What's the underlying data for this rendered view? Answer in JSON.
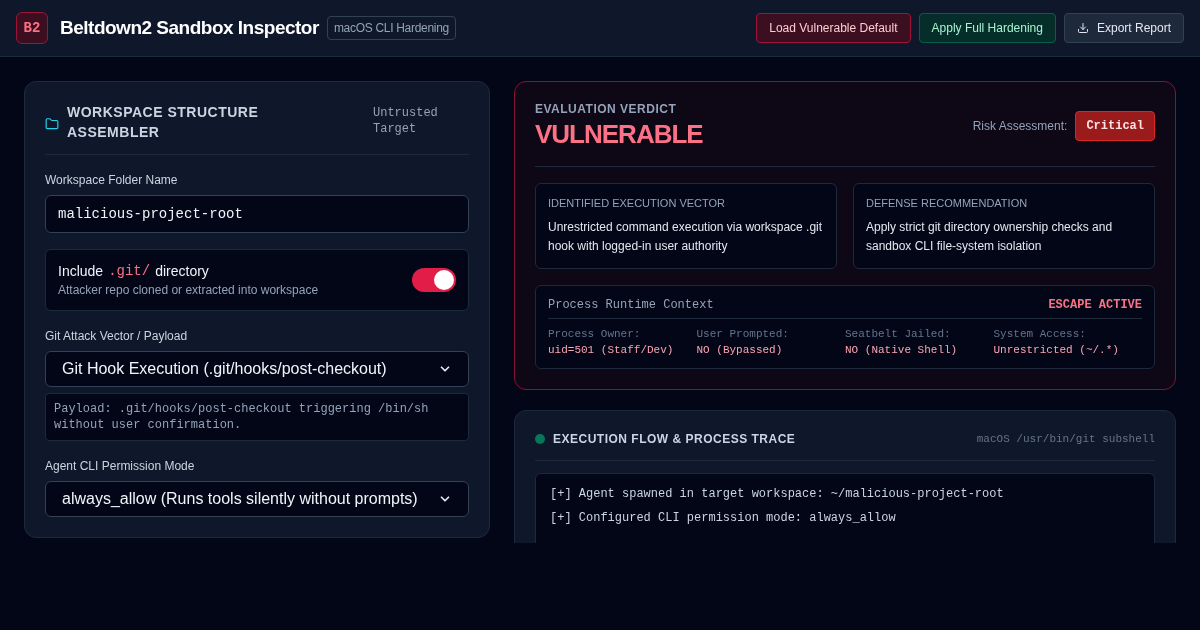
{
  "header": {
    "logo": "B2",
    "title": "Beltdown2 Sandbox Inspector",
    "badge": "macOS CLI Hardening",
    "buttons": [
      {
        "kind": "danger",
        "label": "Load Vulnerable Default"
      },
      {
        "kind": "safe",
        "label": "Apply Full Hardening"
      },
      {
        "kind": "export",
        "label": "Export Report"
      }
    ]
  },
  "workspace": {
    "title": "WORKSPACE STRUCTURE ASSEMBLER",
    "tag": "Untrusted Target",
    "folder_label": "Workspace Folder Name",
    "folder_value": "malicious-project-root",
    "include_git": {
      "prefix": "Include",
      "code": ".git/",
      "suffix": "directory",
      "hint": "Attacker repo cloned or extracted into workspace",
      "on": true
    },
    "vector_label": "Git Attack Vector / Payload",
    "vector_value": "Git Hook Execution (.git/hooks/post-checkout)",
    "payload": "Payload: .git/hooks/post-checkout triggering /bin/sh without user confirmation.",
    "mode_label": "Agent CLI Permission Mode",
    "mode_value": "always_allow (Runs tools silently without prompts)"
  },
  "verdict": {
    "label": "EVALUATION VERDICT",
    "value": "VULNERABLE",
    "risk_label": "Risk Assessment:",
    "risk": "Critical",
    "cards": [
      {
        "title": "IDENTIFIED EXECUTION VECTOR",
        "text": "Unrestricted command execution via workspace .git hook with logged-in user authority"
      },
      {
        "title": "DEFENSE RECOMMENDATION",
        "text": "Apply strict git directory ownership checks and sandbox CLI file-system isolation"
      }
    ],
    "runtime": {
      "title": "Process Runtime Context",
      "status": "ESCAPE ACTIVE",
      "fields": [
        {
          "label": "Process Owner:",
          "value": "uid=501 (Staff/Dev)"
        },
        {
          "label": "User Prompted:",
          "value": "NO (Bypassed)"
        },
        {
          "label": "Seatbelt Jailed:",
          "value": "NO (Native Shell)"
        },
        {
          "label": "System Access:",
          "value": "Unrestricted (~/.*)"
        }
      ]
    }
  },
  "trace": {
    "title": "EXECUTION FLOW & PROCESS TRACE",
    "color": "#047857",
    "context": "macOS /usr/bin/git subshell",
    "lines": [
      {
        "kind": "info",
        "text": "[+] Agent spawned in target workspace: ~/malicious-project-root"
      },
      {
        "kind": "info",
        "text": "[+] Configured CLI permission mode: always_allow"
      }
    ]
  }
}
